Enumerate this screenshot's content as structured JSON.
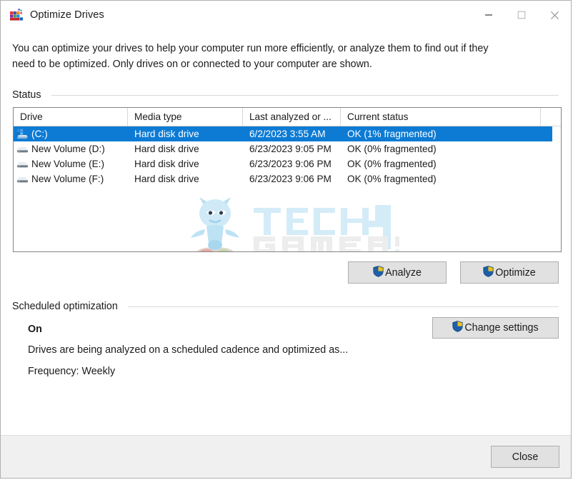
{
  "window": {
    "title": "Optimize Drives",
    "icon": "defrag-blocks-icon",
    "minimize_label": "Minimize",
    "maximize_label": "Maximize",
    "close_label": "Close"
  },
  "intro": {
    "line1": "You can optimize your drives to help your computer run more efficiently, or analyze them to find out if they",
    "line2": "need to be optimized. Only drives on or connected to your computer are shown."
  },
  "status_group": {
    "label": "Status",
    "columns": [
      "Drive",
      "Media type",
      "Last analyzed or ...",
      "Current status"
    ],
    "rows": [
      {
        "icon": "system-drive-icon",
        "drive": "(C:)",
        "media_type": "Hard disk drive",
        "last_analyzed": "6/2/2023 3:55 AM",
        "current_status": "OK (1% fragmented)",
        "selected": true
      },
      {
        "icon": "hard-drive-icon",
        "drive": "New Volume (D:)",
        "media_type": "Hard disk drive",
        "last_analyzed": "6/23/2023 9:05 PM",
        "current_status": "OK (0% fragmented)",
        "selected": false
      },
      {
        "icon": "hard-drive-icon",
        "drive": "New Volume (E:)",
        "media_type": "Hard disk drive",
        "last_analyzed": "6/23/2023 9:06 PM",
        "current_status": "OK (0% fragmented)",
        "selected": false
      },
      {
        "icon": "hard-drive-icon",
        "drive": "New Volume (F:)",
        "media_type": "Hard disk drive",
        "last_analyzed": "6/23/2023 9:06 PM",
        "current_status": "OK (0% fragmented)",
        "selected": false
      }
    ],
    "analyze_label": "Analyze",
    "optimize_label": "Optimize"
  },
  "scheduled": {
    "label": "Scheduled optimization",
    "state": "On",
    "description": "Drives are being analyzed on a scheduled cadence and optimized as...",
    "frequency": "Frequency: Weekly",
    "change_settings_label": "Change settings"
  },
  "footer": {
    "close_label": "Close"
  },
  "watermark": {
    "line1": "TECH",
    "digit": "4",
    "line2": "GAMERS",
    "mascot": "tech4gamers-mascot-icon"
  },
  "colors": {
    "selection_blue": "#0d7bd4",
    "window_bg": "#ffffff",
    "footer_bg": "#f0f0f0",
    "button_face": "#e1e1e1",
    "button_border": "#adadad",
    "watermark_blue": "#cfe6f5",
    "watermark_gray": "#ebebeb",
    "shield_blue": "#1f5fa9",
    "shield_gold": "#f0c419"
  }
}
